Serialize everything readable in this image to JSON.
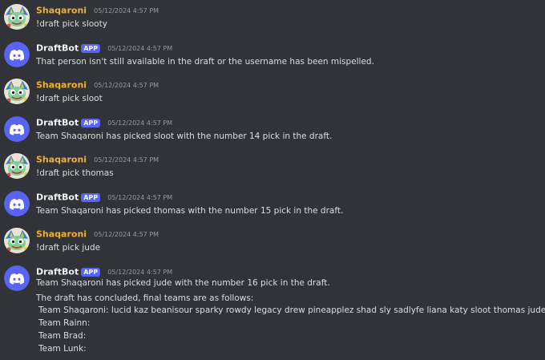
{
  "users": {
    "human": {
      "name": "Shaqaroni",
      "color": "#f0b232"
    },
    "bot": {
      "name": "DraftBot",
      "badge": "APP"
    }
  },
  "accent_colors": {
    "background": "#313338",
    "bot_badge": "#5865f2",
    "text": "#dbdee1",
    "timestamp": "#949ba4"
  },
  "messages": [
    {
      "author": "Shaqaroni",
      "timestamp": "05/12/2024 4:57 PM",
      "text": "!draft pick slooty"
    },
    {
      "author": "DraftBot",
      "timestamp": "05/12/2024 4:57 PM",
      "text": "That person isn't still available in the draft or the username has been mispelled."
    },
    {
      "author": "Shaqaroni",
      "timestamp": "05/12/2024 4:57 PM",
      "text": "!draft pick sloot"
    },
    {
      "author": "DraftBot",
      "timestamp": "05/12/2024 4:57 PM",
      "text": "Team Shaqaroni has picked sloot with the number 14 pick in the draft."
    },
    {
      "author": "Shaqaroni",
      "timestamp": "05/12/2024 4:57 PM",
      "text": "!draft pick thomas"
    },
    {
      "author": "DraftBot",
      "timestamp": "05/12/2024 4:57 PM",
      "text": "Team Shaqaroni has picked thomas with the number 15 pick in the draft."
    },
    {
      "author": "Shaqaroni",
      "timestamp": "05/12/2024 4:57 PM",
      "text": "!draft pick jude"
    },
    {
      "author": "DraftBot",
      "timestamp": "05/12/2024 4:57 PM",
      "text": "Team Shaqaroni has picked jude with the number 16 pick in the draft.",
      "extra_lines": [
        "The draft has concluded, final teams are as follows:",
        "Team Shaqaroni: lucid kaz beanisour sparky rowdy legacy drew pineapplez shad sly sadlyfe liana katy sloot thomas jude",
        "Team Rainn:",
        "Team Brad:",
        "Team Lunk:"
      ]
    }
  ],
  "icons": {
    "user_avatar": "shaqaroni-avatar-icon",
    "bot_avatar": "discord-logo-icon"
  }
}
